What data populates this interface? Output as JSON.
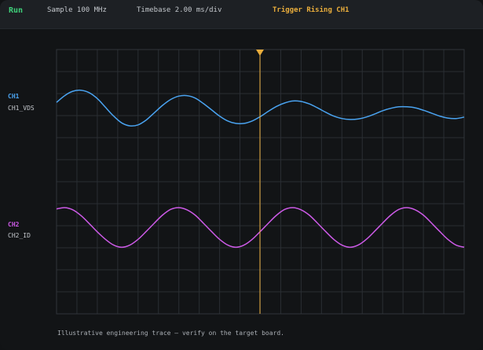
{
  "topbar": {
    "status": "Run",
    "sample": "Sample 100 MHz",
    "timebase": "Timebase 2.00 ms/div",
    "trigger": "Trigger Rising CH1"
  },
  "colors": {
    "run": "#3fd07a",
    "trigger": "#e9ad3c",
    "ch1": "#4aa3f0",
    "ch2": "#cc5ae6",
    "grid": "#2a2e33",
    "frame": "#30353a"
  },
  "channels": [
    {
      "id": "CH1",
      "name": "CH1_VDS",
      "color": "#4aa3f0"
    },
    {
      "id": "CH2",
      "name": "CH2_ID",
      "color": "#cc5ae6"
    }
  ],
  "footer": "Illustrative engineering trace — verify on the target board.",
  "chart_data": [
    {
      "type": "line",
      "series": [
        {
          "name": "CH1_VDS",
          "x": [
            0,
            0.02,
            0.04,
            0.06,
            0.08,
            0.1,
            0.12,
            0.14,
            0.16,
            0.18,
            0.2,
            0.22,
            0.24,
            0.26,
            0.28,
            0.3,
            0.32,
            0.34,
            0.36,
            0.38,
            0.4,
            0.42,
            0.44,
            0.46,
            0.48,
            0.5,
            0.52,
            0.54,
            0.56,
            0.58,
            0.6,
            0.62,
            0.64,
            0.66,
            0.68,
            0.7,
            0.72,
            0.74,
            0.76,
            0.78,
            0.8,
            0.82,
            0.84,
            0.86,
            0.88,
            0.9,
            0.92,
            0.94,
            0.96,
            0.98,
            1
          ],
          "y": [
            0.48,
            0.62,
            0.71,
            0.73,
            0.68,
            0.56,
            0.38,
            0.2,
            0.06,
            0,
            0.02,
            0.12,
            0.27,
            0.42,
            0.54,
            0.61,
            0.62,
            0.57,
            0.46,
            0.33,
            0.2,
            0.1,
            0.05,
            0.05,
            0.1,
            0.19,
            0.3,
            0.4,
            0.47,
            0.51,
            0.5,
            0.45,
            0.37,
            0.28,
            0.2,
            0.15,
            0.13,
            0.14,
            0.18,
            0.24,
            0.31,
            0.36,
            0.39,
            0.39,
            0.37,
            0.32,
            0.26,
            0.2,
            0.16,
            0.15,
            0.18
          ]
        }
      ]
    },
    {
      "type": "line",
      "series": [
        {
          "name": "CH2_ID",
          "x": [
            0,
            0.02,
            0.04,
            0.06,
            0.08,
            0.1,
            0.12,
            0.14,
            0.16,
            0.18,
            0.2,
            0.22,
            0.24,
            0.26,
            0.28,
            0.3,
            0.32,
            0.34,
            0.36,
            0.38,
            0.4,
            0.42,
            0.44,
            0.46,
            0.48,
            0.5,
            0.52,
            0.54,
            0.56,
            0.58,
            0.6,
            0.62,
            0.64,
            0.66,
            0.68,
            0.7,
            0.72,
            0.74,
            0.76,
            0.78,
            0.8,
            0.82,
            0.84,
            0.86,
            0.88,
            0.9,
            0.92,
            0.94,
            0.96,
            0.98,
            1
          ],
          "y": [
            0.97,
            1,
            0.95,
            0.82,
            0.64,
            0.45,
            0.28,
            0.15,
            0.1,
            0.15,
            0.28,
            0.46,
            0.65,
            0.83,
            0.96,
            1,
            0.95,
            0.83,
            0.65,
            0.46,
            0.28,
            0.15,
            0.1,
            0.15,
            0.28,
            0.46,
            0.65,
            0.83,
            0.96,
            1,
            0.95,
            0.83,
            0.65,
            0.46,
            0.28,
            0.15,
            0.1,
            0.15,
            0.28,
            0.46,
            0.65,
            0.83,
            0.96,
            1,
            0.95,
            0.83,
            0.65,
            0.46,
            0.28,
            0.15,
            0.1
          ]
        }
      ]
    }
  ]
}
